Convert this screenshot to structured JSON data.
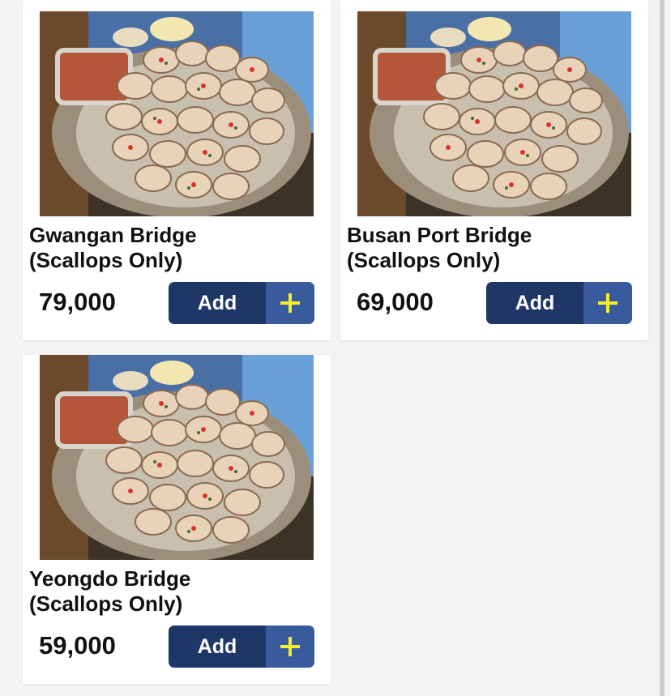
{
  "products": [
    {
      "name_line1": "Gwangan Bridge",
      "name_line2": "(Scallops Only)",
      "price": "79,000",
      "add_label": "Add"
    },
    {
      "name_line1": "Busan Port Bridge",
      "name_line2": "(Scallops Only)",
      "price": "69,000",
      "add_label": "Add"
    },
    {
      "name_line1": "Yeongdo Bridge",
      "name_line2": "(Scallops Only)",
      "price": "59,000",
      "add_label": "Add"
    }
  ],
  "icons": {
    "add": "plus-icon"
  },
  "colors": {
    "button_dark": "#1e3767",
    "button_light": "#3a5a9e",
    "plus": "#f4ef2b"
  }
}
